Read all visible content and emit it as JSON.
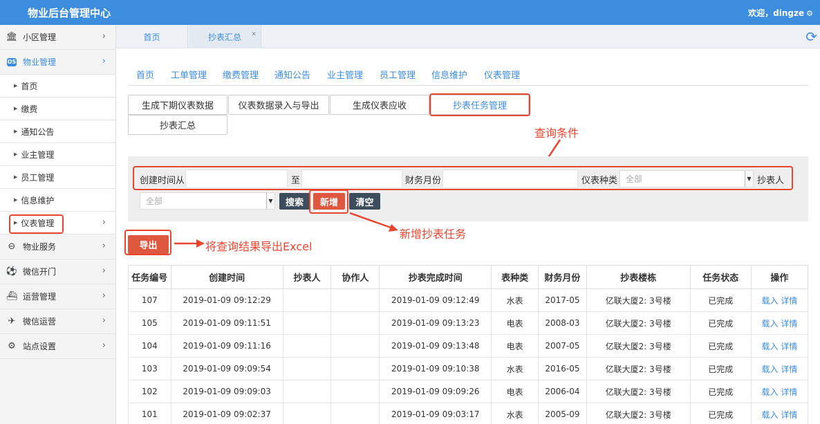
{
  "header": {
    "title": "物业后台管理中心",
    "welcome": "欢迎，dingze"
  },
  "sidebar": {
    "top": [
      {
        "label": "小区管理",
        "icon": "bank-icon"
      },
      {
        "label": "物业管理",
        "icon": "os-icon"
      }
    ],
    "subs": [
      {
        "label": "首页"
      },
      {
        "label": "缴费"
      },
      {
        "label": "通知公告"
      },
      {
        "label": "业主管理"
      },
      {
        "label": "员工管理"
      },
      {
        "label": "信息维护"
      },
      {
        "label": "仪表管理"
      }
    ],
    "bottom": [
      {
        "label": "物业服务",
        "icon": "toggle-icon"
      },
      {
        "label": "微信开门",
        "icon": "soccer-icon"
      },
      {
        "label": "运营管理",
        "icon": "ship-icon"
      },
      {
        "label": "微信运营",
        "icon": "paper-plane-icon"
      },
      {
        "label": "站点设置",
        "icon": "gears-icon"
      }
    ]
  },
  "tabs": [
    {
      "label": "首页"
    },
    {
      "label": "抄表汇总"
    }
  ],
  "mainnav": [
    "首页",
    "工单管理",
    "缴费管理",
    "通知公告",
    "业主管理",
    "员工管理",
    "信息维护",
    "仪表管理"
  ],
  "subbuttons": [
    "生成下期仪表数据",
    "仪表数据录入与导出",
    "生成仪表应收",
    "抄表任务管理",
    "抄表汇总"
  ],
  "query": {
    "created_from": "创建时间从",
    "to": "至",
    "fin_month": "财务月份",
    "meter_type": "仪表种类",
    "meter_type_value": "全部",
    "reader": "抄表人",
    "reader_value": "全部",
    "search": "搜索",
    "add": "新增",
    "clear": "清空"
  },
  "export_label": "导出",
  "annotations": {
    "query": "查询条件",
    "add": "新增抄表任务",
    "export": "将查询结果导出Excel"
  },
  "table": {
    "headers": [
      "任务编号",
      "创建时间",
      "抄表人",
      "协作人",
      "抄表完成时间",
      "表种类",
      "财务月份",
      "抄表楼栋",
      "任务状态",
      "操作"
    ],
    "rows": [
      [
        "107",
        "2019-01-09 09:12:29",
        "",
        "",
        "2019-01-09 09:12:49",
        "水表",
        "2017-05",
        "亿联大厦2: 3号楼",
        "已完成"
      ],
      [
        "105",
        "2019-01-09 09:11:51",
        "",
        "",
        "2019-01-09 09:13:23",
        "电表",
        "2008-03",
        "亿联大厦2: 3号楼",
        "已完成"
      ],
      [
        "104",
        "2019-01-09 09:11:16",
        "",
        "",
        "2019-01-09 09:13:48",
        "电表",
        "2007-05",
        "亿联大厦2: 3号楼",
        "已完成"
      ],
      [
        "103",
        "2019-01-09 09:09:54",
        "",
        "",
        "2019-01-09 09:10:38",
        "水表",
        "2016-05",
        "亿联大厦2: 3号楼",
        "已完成"
      ],
      [
        "102",
        "2019-01-09 09:09:03",
        "",
        "",
        "2019-01-09 09:09:26",
        "电表",
        "2006-04",
        "亿联大厦2: 3号楼",
        "已完成"
      ],
      [
        "101",
        "2019-01-09 09:02:37",
        "",
        "",
        "2019-01-09 09:03:17",
        "水表",
        "2005-09",
        "亿联大厦2: 3号楼",
        "已完成"
      ]
    ],
    "op_load": "载入",
    "op_detail": "详情"
  }
}
